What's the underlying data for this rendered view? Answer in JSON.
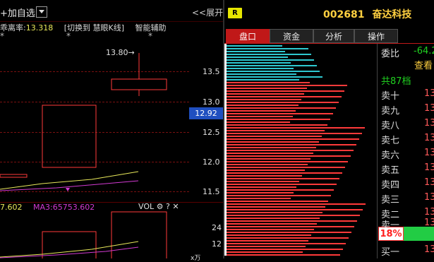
{
  "toolbar": {
    "add_favorite": "+加自选",
    "expand": "<<展开"
  },
  "indicator": {
    "deviation_label": "乖离率:",
    "deviation_value": "13.318",
    "switch_label": "[切换到 慧眼K线]",
    "assist_label": "智能辅助"
  },
  "price_axis": {
    "ticks": [
      "13.5",
      "13.0",
      "12.5",
      "12.0",
      "11.5"
    ],
    "high_marker": "13.80→",
    "current_price": "12.92"
  },
  "header": {
    "badge": "R",
    "code": "002681",
    "name": "奋达科技"
  },
  "tabs": [
    {
      "label": "盘口",
      "active": true
    },
    {
      "label": "资金",
      "active": false
    },
    {
      "label": "分析",
      "active": false
    },
    {
      "label": "操作",
      "active": false
    }
  ],
  "order_book": {
    "webi_label": "委比",
    "webi_value": "-64.2",
    "check_more": "查看",
    "levels_label": "共87档",
    "rows": [
      {
        "label": "卖十",
        "price": "13"
      },
      {
        "label": "卖九",
        "price": "13"
      },
      {
        "label": "卖八",
        "price": "13"
      },
      {
        "label": "卖七",
        "price": "13"
      },
      {
        "label": "卖六",
        "price": "13"
      },
      {
        "label": "卖五",
        "price": "13"
      },
      {
        "label": "卖四",
        "price": "13"
      },
      {
        "label": "卖三",
        "price": "13"
      },
      {
        "label": "卖二",
        "price": "13"
      },
      {
        "label": "卖一",
        "price": "13"
      }
    ],
    "ratio_percent": "18%",
    "ratio_value": 0.18,
    "buy1_label": "买一",
    "buy1_price": "13"
  },
  "volume_panel": {
    "ma_partial": "7.602",
    "ma3_label": "MA3:65753.602",
    "vol_label": "VOL",
    "gear_icon": "gear-icon",
    "help_icon": "question-icon",
    "close_icon": "close-icon",
    "ticks": [
      "24",
      "12"
    ],
    "unit_partial": "x万"
  },
  "colors": {
    "up_red": "#ff3a3a",
    "grid_red": "#7a1010",
    "tab_active": "#c01818",
    "highlight_blue": "#1f4fc0",
    "green": "#20d020",
    "yellow": "#e6e600",
    "cyan": "#2ec8d0"
  }
}
